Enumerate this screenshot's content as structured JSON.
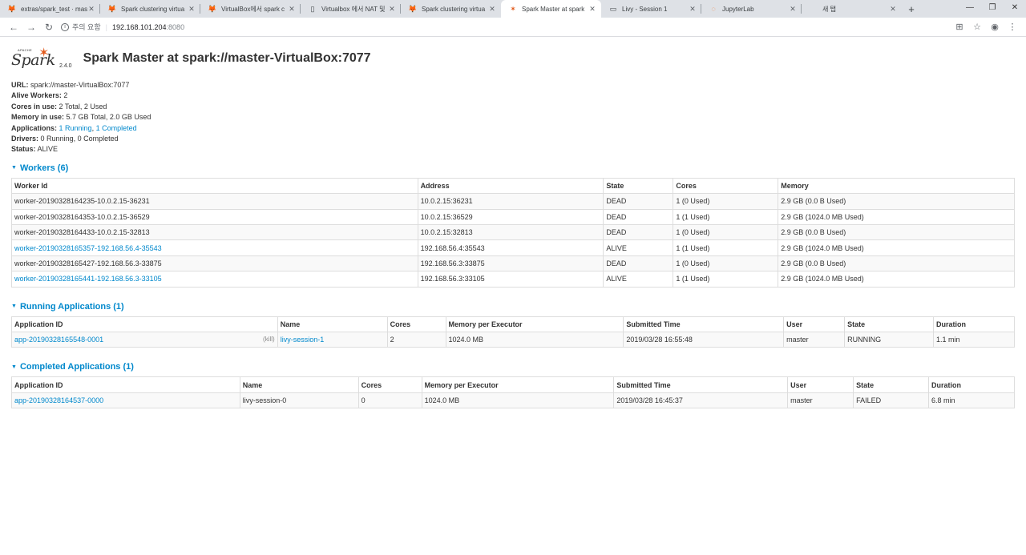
{
  "browser": {
    "tabs": [
      {
        "title": "extras/spark_test · mas",
        "icon": "gitlab-icon"
      },
      {
        "title": "Spark clustering virtua",
        "icon": "gitlab-icon"
      },
      {
        "title": "VirtualBox에서 spark c",
        "icon": "gitlab-icon"
      },
      {
        "title": "Virtualbox 에서 NAT 및",
        "icon": "document-icon"
      },
      {
        "title": "Spark clustering virtua",
        "icon": "gitlab-icon"
      },
      {
        "title": "Spark Master at spark",
        "icon": "spark-icon"
      },
      {
        "title": "Livy - Session 1",
        "icon": "page-icon"
      },
      {
        "title": "JupyterLab",
        "icon": "jupyter-icon"
      },
      {
        "title": "새 탭",
        "icon": ""
      }
    ],
    "address": {
      "security_label": "주의 요함",
      "host": "192.168.101.204",
      "port": ":8080"
    }
  },
  "header": {
    "logo_text": "Spark",
    "logo_apache": "APACHE",
    "version": "2.4.0",
    "title": "Spark Master at spark://master-VirtualBox:7077"
  },
  "summary": {
    "url_label": "URL:",
    "url_value": "spark://master-VirtualBox:7077",
    "workers_label": "Alive Workers:",
    "workers_value": "2",
    "cores_label": "Cores in use:",
    "cores_value": "2 Total, 2 Used",
    "memory_label": "Memory in use:",
    "memory_value": "5.7 GB Total, 2.0 GB Used",
    "apps_label": "Applications:",
    "apps_running": "1 Running",
    "apps_sep": ",",
    "apps_completed": "1 Completed",
    "drivers_label": "Drivers:",
    "drivers_value": "0 Running, 0 Completed",
    "status_label": "Status:",
    "status_value": "ALIVE"
  },
  "workers": {
    "heading": "Workers (6)",
    "columns": [
      "Worker Id",
      "Address",
      "State",
      "Cores",
      "Memory"
    ],
    "rows": [
      {
        "id": "worker-20190328164235-10.0.2.15-36231",
        "link": false,
        "address": "10.0.2.15:36231",
        "state": "DEAD",
        "cores": "1 (0 Used)",
        "memory": "2.9 GB (0.0 B Used)"
      },
      {
        "id": "worker-20190328164353-10.0.2.15-36529",
        "link": false,
        "address": "10.0.2.15:36529",
        "state": "DEAD",
        "cores": "1 (1 Used)",
        "memory": "2.9 GB (1024.0 MB Used)"
      },
      {
        "id": "worker-20190328164433-10.0.2.15-32813",
        "link": false,
        "address": "10.0.2.15:32813",
        "state": "DEAD",
        "cores": "1 (0 Used)",
        "memory": "2.9 GB (0.0 B Used)"
      },
      {
        "id": "worker-20190328165357-192.168.56.4-35543",
        "link": true,
        "address": "192.168.56.4:35543",
        "state": "ALIVE",
        "cores": "1 (1 Used)",
        "memory": "2.9 GB (1024.0 MB Used)"
      },
      {
        "id": "worker-20190328165427-192.168.56.3-33875",
        "link": false,
        "address": "192.168.56.3:33875",
        "state": "DEAD",
        "cores": "1 (0 Used)",
        "memory": "2.9 GB (0.0 B Used)"
      },
      {
        "id": "worker-20190328165441-192.168.56.3-33105",
        "link": true,
        "address": "192.168.56.3:33105",
        "state": "ALIVE",
        "cores": "1 (1 Used)",
        "memory": "2.9 GB (1024.0 MB Used)"
      }
    ]
  },
  "running_apps": {
    "heading": "Running Applications (1)",
    "columns": [
      "Application ID",
      "Name",
      "Cores",
      "Memory per Executor",
      "Submitted Time",
      "User",
      "State",
      "Duration"
    ],
    "rows": [
      {
        "id": "app-20190328165548-0001",
        "kill": "(kill)",
        "name": "livy-session-1",
        "cores": "2",
        "memory": "1024.0 MB",
        "submitted": "2019/03/28 16:55:48",
        "user": "master",
        "state": "RUNNING",
        "duration": "1.1 min"
      }
    ]
  },
  "completed_apps": {
    "heading": "Completed Applications (1)",
    "columns": [
      "Application ID",
      "Name",
      "Cores",
      "Memory per Executor",
      "Submitted Time",
      "User",
      "State",
      "Duration"
    ],
    "rows": [
      {
        "id": "app-20190328164537-0000",
        "name": "livy-session-0",
        "cores": "0",
        "memory": "1024.0 MB",
        "submitted": "2019/03/28 16:45:37",
        "user": "master",
        "state": "FAILED",
        "duration": "6.8 min"
      }
    ]
  }
}
